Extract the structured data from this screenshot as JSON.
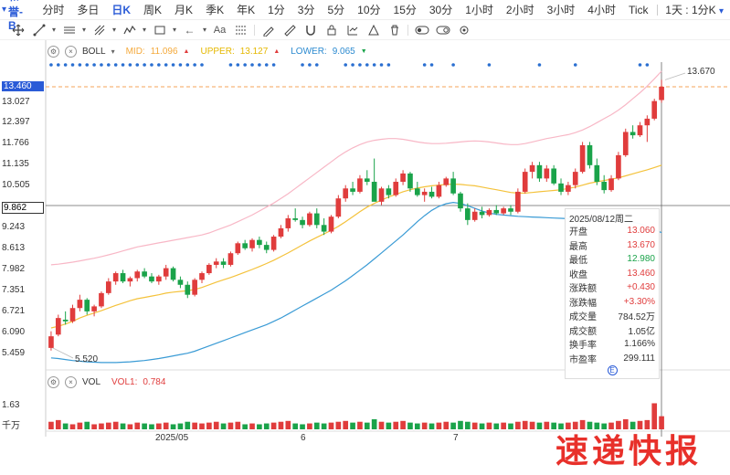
{
  "topbar": {
    "symbol_name": "和誉-B",
    "periods": [
      "分时",
      "多日",
      "日K",
      "周K",
      "月K",
      "季K",
      "年K",
      "1分",
      "3分",
      "5分",
      "10分",
      "15分",
      "30分",
      "1小时",
      "2小时",
      "3小时",
      "4小时",
      "Tick"
    ],
    "active": "日K",
    "multi_period": "1天 : 1分K"
  },
  "toolbar": {
    "tools": [
      "crosshair-icon",
      "line-icon",
      "segment-icon",
      "multi-line-icon",
      "channel-icon",
      "pitchfork-icon",
      "brush-icon",
      "arrow-left-icon",
      "text-icon",
      "magnet-icon",
      "lock-icon",
      "ruler-icon",
      "measure-icon",
      "arc-icon",
      "shape-icon",
      "eye-icon",
      "delete-icon",
      "eye-toggle-icon",
      "settings-icon"
    ]
  },
  "boll": {
    "name": "BOLL",
    "mid_label": "MID:",
    "mid_value": "11.096",
    "upper_label": "UPPER:",
    "upper_value": "13.127",
    "lower_label": "LOWER:",
    "lower_value": "9.065",
    "colors": {
      "mid": "#f4a93b",
      "upper": "#f0c838",
      "lower": "#3a9bd5"
    }
  },
  "vol": {
    "name": "VOL",
    "vol1_label": "VOL1:",
    "vol1_value": "0.784",
    "y_top": "1.63",
    "unit": "千万"
  },
  "price_axis": {
    "ticks": [
      "13.460",
      "13.027",
      "12.397",
      "11.766",
      "11.135",
      "10.505",
      "9.862",
      "9.243",
      "8.613",
      "7.982",
      "7.351",
      "6.721",
      "6.090",
      "5.459"
    ],
    "current_price": "13.460",
    "cross_price": "9.862",
    "high_label": "13.670",
    "low_label": "5.520"
  },
  "x_axis": {
    "labels": [
      "2025/05",
      "6",
      "7"
    ]
  },
  "tooltip": {
    "date": "2025/08/12周二",
    "rows": [
      {
        "k": "开盘",
        "v": "13.060",
        "c": "up"
      },
      {
        "k": "最高",
        "v": "13.670",
        "c": "up"
      },
      {
        "k": "最低",
        "v": "12.980",
        "c": "dn"
      },
      {
        "k": "收盘",
        "v": "13.460",
        "c": "up"
      },
      {
        "k": "涨跌额",
        "v": "+0.430",
        "c": "up"
      },
      {
        "k": "涨跌幅",
        "v": "+3.30%",
        "c": "up"
      },
      {
        "k": "成交量",
        "v": "784.52万",
        "c": "nu"
      },
      {
        "k": "成交额",
        "v": "1.05亿",
        "c": "nu"
      },
      {
        "k": "换手率",
        "v": "1.166%",
        "c": "nu"
      },
      {
        "k": "市盈率",
        "v": "299.111",
        "c": "nu"
      }
    ]
  },
  "watermark": "速递快报",
  "chart_data": {
    "type": "candlestick",
    "candles": [
      [
        5.6,
        6.1,
        5.52,
        5.95
      ],
      [
        6.0,
        6.6,
        5.95,
        6.5
      ],
      [
        6.45,
        6.7,
        6.3,
        6.4
      ],
      [
        6.4,
        6.9,
        6.35,
        6.8
      ],
      [
        6.8,
        7.2,
        6.7,
        7.05
      ],
      [
        7.05,
        7.1,
        6.6,
        6.7
      ],
      [
        6.7,
        6.9,
        6.55,
        6.85
      ],
      [
        6.85,
        7.3,
        6.8,
        7.25
      ],
      [
        7.25,
        7.7,
        7.2,
        7.6
      ],
      [
        7.6,
        7.9,
        7.5,
        7.85
      ],
      [
        7.85,
        7.95,
        7.55,
        7.6
      ],
      [
        7.6,
        7.75,
        7.45,
        7.7
      ],
      [
        7.7,
        7.95,
        7.6,
        7.9
      ],
      [
        7.9,
        8.0,
        7.7,
        7.75
      ],
      [
        7.75,
        7.85,
        7.55,
        7.6
      ],
      [
        7.6,
        7.8,
        7.5,
        7.75
      ],
      [
        7.75,
        8.1,
        7.65,
        8.0
      ],
      [
        8.0,
        8.05,
        7.6,
        7.65
      ],
      [
        7.65,
        7.75,
        7.4,
        7.5
      ],
      [
        7.5,
        7.6,
        7.1,
        7.2
      ],
      [
        7.2,
        7.7,
        7.15,
        7.65
      ],
      [
        7.65,
        7.9,
        7.55,
        7.85
      ],
      [
        7.85,
        8.15,
        7.8,
        8.1
      ],
      [
        8.1,
        8.3,
        8.0,
        8.2
      ],
      [
        8.2,
        8.3,
        8.0,
        8.1
      ],
      [
        8.1,
        8.5,
        8.05,
        8.45
      ],
      [
        8.45,
        8.8,
        8.4,
        8.75
      ],
      [
        8.75,
        8.85,
        8.55,
        8.6
      ],
      [
        8.6,
        8.9,
        8.5,
        8.85
      ],
      [
        8.85,
        8.95,
        8.6,
        8.7
      ],
      [
        8.7,
        8.8,
        8.45,
        8.55
      ],
      [
        8.55,
        9.0,
        8.5,
        8.95
      ],
      [
        8.95,
        9.3,
        8.9,
        9.2
      ],
      [
        9.2,
        9.6,
        9.1,
        9.5
      ],
      [
        9.5,
        9.8,
        9.4,
        9.45
      ],
      [
        9.45,
        9.55,
        9.2,
        9.3
      ],
      [
        9.3,
        9.7,
        9.25,
        9.65
      ],
      [
        9.65,
        9.8,
        9.2,
        9.3
      ],
      [
        9.3,
        9.5,
        9.0,
        9.1
      ],
      [
        9.1,
        9.6,
        9.05,
        9.55
      ],
      [
        9.55,
        10.2,
        9.5,
        10.1
      ],
      [
        10.1,
        10.5,
        10.0,
        10.4
      ],
      [
        10.4,
        10.6,
        10.2,
        10.3
      ],
      [
        10.3,
        10.8,
        10.25,
        10.7
      ],
      [
        10.7,
        10.95,
        10.5,
        10.6
      ],
      [
        10.6,
        11.3,
        10.5,
        10.0
      ],
      [
        10.0,
        10.45,
        9.9,
        10.4
      ],
      [
        10.4,
        10.5,
        10.1,
        10.2
      ],
      [
        10.2,
        10.7,
        10.15,
        10.6
      ],
      [
        10.6,
        10.95,
        10.5,
        10.85
      ],
      [
        10.85,
        10.9,
        10.3,
        10.4
      ],
      [
        10.4,
        10.6,
        10.15,
        10.2
      ],
      [
        10.2,
        10.4,
        10.0,
        10.3
      ],
      [
        10.3,
        10.45,
        10.1,
        10.15
      ],
      [
        10.15,
        10.6,
        10.1,
        10.5
      ],
      [
        10.5,
        10.75,
        10.45,
        10.7
      ],
      [
        10.7,
        10.9,
        10.2,
        10.25
      ],
      [
        10.25,
        10.3,
        9.7,
        9.8
      ],
      [
        9.8,
        9.95,
        9.3,
        9.45
      ],
      [
        9.45,
        9.8,
        9.4,
        9.7
      ],
      [
        9.7,
        9.85,
        9.5,
        9.6
      ],
      [
        9.6,
        9.8,
        9.55,
        9.75
      ],
      [
        9.75,
        9.9,
        9.6,
        9.65
      ],
      [
        9.65,
        9.85,
        9.6,
        9.8
      ],
      [
        9.8,
        9.9,
        9.6,
        9.7
      ],
      [
        9.7,
        10.4,
        9.65,
        10.3
      ],
      [
        10.3,
        11.0,
        10.25,
        10.9
      ],
      [
        10.9,
        11.2,
        10.7,
        11.1
      ],
      [
        11.1,
        11.2,
        10.6,
        10.7
      ],
      [
        10.7,
        11.1,
        10.6,
        11.0
      ],
      [
        11.0,
        11.1,
        10.5,
        10.55
      ],
      [
        10.55,
        10.7,
        10.2,
        10.3
      ],
      [
        10.3,
        10.6,
        10.2,
        10.5
      ],
      [
        10.5,
        11.0,
        10.4,
        10.9
      ],
      [
        10.9,
        11.8,
        10.85,
        11.7
      ],
      [
        11.7,
        11.8,
        11.0,
        11.1
      ],
      [
        11.1,
        11.3,
        10.5,
        10.6
      ],
      [
        10.6,
        10.8,
        10.25,
        10.35
      ],
      [
        10.35,
        10.8,
        10.3,
        10.7
      ],
      [
        10.7,
        11.5,
        10.65,
        11.4
      ],
      [
        11.4,
        12.2,
        11.35,
        12.1
      ],
      [
        12.1,
        12.3,
        11.9,
        12.0
      ],
      [
        12.0,
        12.4,
        11.95,
        12.3
      ],
      [
        12.3,
        12.6,
        11.8,
        12.5
      ],
      [
        12.5,
        13.1,
        12.45,
        13.03
      ],
      [
        13.06,
        13.67,
        12.98,
        13.46
      ]
    ],
    "boll_mid": [
      6.2,
      6.25,
      6.32,
      6.4,
      6.5,
      6.58,
      6.65,
      6.72,
      6.8,
      6.88,
      6.95,
      7.02,
      7.08,
      7.12,
      7.16,
      7.2,
      7.25,
      7.28,
      7.3,
      7.32,
      7.36,
      7.42,
      7.5,
      7.58,
      7.65,
      7.72,
      7.8,
      7.88,
      7.96,
      8.05,
      8.14,
      8.24,
      8.35,
      8.46,
      8.58,
      8.7,
      8.82,
      8.93,
      9.03,
      9.14,
      9.26,
      9.4,
      9.55,
      9.7,
      9.84,
      9.95,
      10.05,
      10.14,
      10.22,
      10.3,
      10.36,
      10.41,
      10.45,
      10.48,
      10.5,
      10.52,
      10.53,
      10.52,
      10.5,
      10.48,
      10.44,
      10.4,
      10.36,
      10.32,
      10.28,
      10.26,
      10.26,
      10.28,
      10.3,
      10.32,
      10.34,
      10.36,
      10.4,
      10.44,
      10.5,
      10.56,
      10.6,
      10.64,
      10.68,
      10.72,
      10.78,
      10.84,
      10.9,
      10.96,
      11.03,
      11.1
    ],
    "boll_upper": [
      7.3,
      7.32,
      7.35,
      7.38,
      7.42,
      7.46,
      7.5,
      7.55,
      7.6,
      7.66,
      7.72,
      7.78,
      7.84,
      7.88,
      7.92,
      7.96,
      8.0,
      8.04,
      8.08,
      8.12,
      8.16,
      8.2,
      8.26,
      8.34,
      8.42,
      8.5,
      8.6,
      8.7,
      8.8,
      8.92,
      9.04,
      9.16,
      9.3,
      9.44,
      9.6,
      9.76,
      9.92,
      10.08,
      10.24,
      10.4,
      10.56,
      10.7,
      10.82,
      10.92,
      11.0,
      11.05,
      11.08,
      11.1,
      11.1,
      11.08,
      11.04,
      11.0,
      10.97,
      10.95,
      10.95,
      10.96,
      10.98,
      11.0,
      11.02,
      11.03,
      11.02,
      11.0,
      10.97,
      10.94,
      10.92,
      10.92,
      10.95,
      11.0,
      11.05,
      11.1,
      11.14,
      11.18,
      11.22,
      11.28,
      11.36,
      11.46,
      11.58,
      11.7,
      11.82,
      11.96,
      12.12,
      12.3,
      12.48,
      12.68,
      12.9,
      13.13
    ],
    "boll_lower": [
      5.3,
      5.28,
      5.25,
      5.22,
      5.2,
      5.18,
      5.17,
      5.16,
      5.16,
      5.16,
      5.17,
      5.18,
      5.2,
      5.22,
      5.25,
      5.28,
      5.32,
      5.36,
      5.4,
      5.44,
      5.5,
      5.58,
      5.66,
      5.74,
      5.82,
      5.9,
      5.98,
      6.06,
      6.14,
      6.22,
      6.3,
      6.4,
      6.5,
      6.62,
      6.74,
      6.86,
      6.98,
      7.1,
      7.22,
      7.34,
      7.48,
      7.62,
      7.78,
      7.94,
      8.1,
      8.28,
      8.46,
      8.64,
      8.82,
      9.0,
      9.2,
      9.4,
      9.58,
      9.74,
      9.86,
      9.94,
      9.98,
      9.95,
      9.88,
      9.8,
      9.72,
      9.66,
      9.62,
      9.6,
      9.58,
      9.56,
      9.55,
      9.54,
      9.53,
      9.52,
      9.51,
      9.5,
      9.49,
      9.48,
      9.47,
      9.46,
      9.45,
      9.44,
      9.43,
      9.42,
      9.4,
      9.38,
      9.34,
      9.26,
      9.16,
      9.07
    ],
    "volume": [
      0.45,
      0.55,
      0.35,
      0.3,
      0.4,
      0.45,
      0.3,
      0.35,
      0.4,
      0.45,
      0.35,
      0.3,
      0.4,
      0.35,
      0.3,
      0.35,
      0.4,
      0.3,
      0.35,
      0.45,
      0.4,
      0.35,
      0.4,
      0.45,
      0.35,
      0.4,
      0.45,
      0.3,
      0.35,
      0.3,
      0.35,
      0.4,
      0.45,
      0.5,
      0.35,
      0.3,
      0.35,
      0.4,
      0.35,
      0.4,
      0.45,
      0.5,
      0.4,
      0.45,
      0.4,
      0.6,
      0.45,
      0.4,
      0.45,
      0.5,
      0.4,
      0.35,
      0.4,
      0.35,
      0.4,
      0.45,
      0.4,
      0.5,
      0.45,
      0.4,
      0.35,
      0.4,
      0.35,
      0.4,
      0.35,
      0.45,
      0.5,
      0.45,
      0.4,
      0.45,
      0.4,
      0.35,
      0.4,
      0.45,
      0.55,
      0.45,
      0.4,
      0.35,
      0.4,
      0.5,
      0.6,
      0.45,
      0.5,
      0.55,
      1.55,
      0.78
    ]
  }
}
